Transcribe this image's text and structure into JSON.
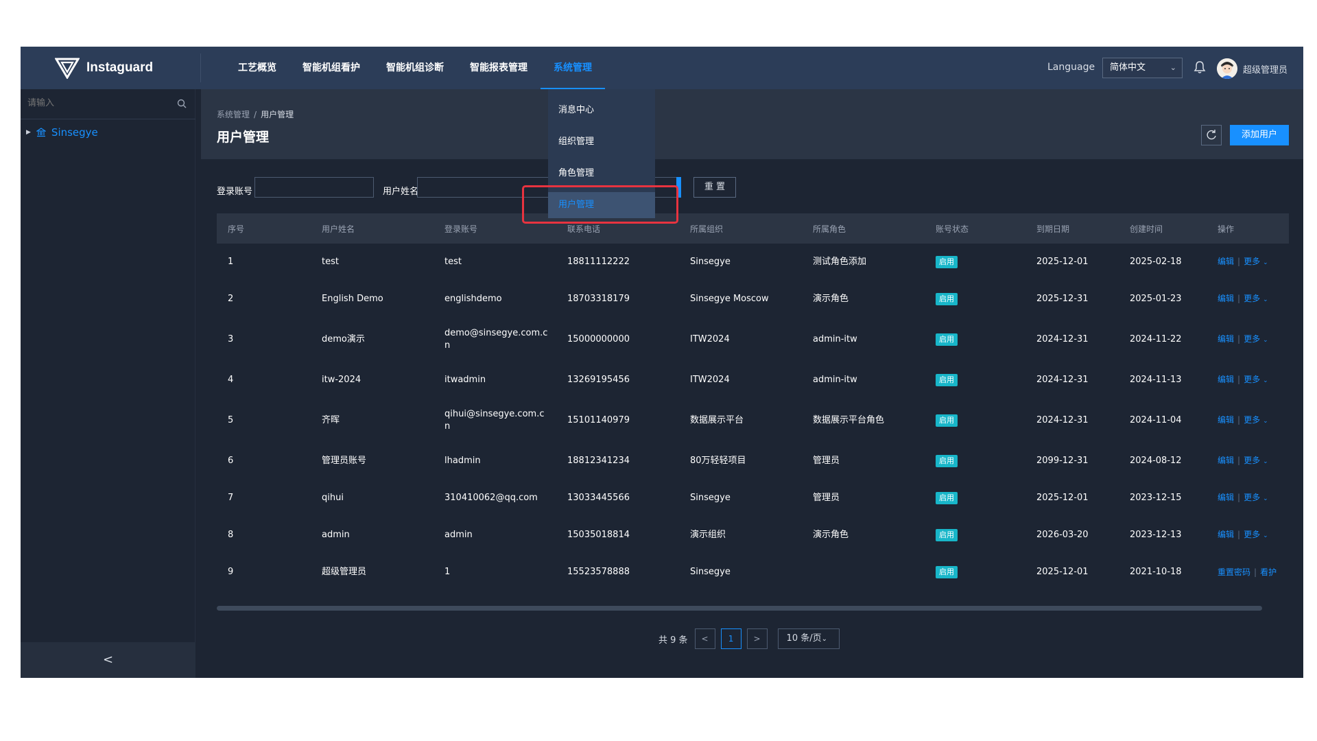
{
  "app": {
    "name": "Instaguard",
    "nav": [
      "工艺概览",
      "智能机组看护",
      "智能机组诊断",
      "智能报表管理",
      "系统管理"
    ],
    "nav_active_index": 4,
    "language_label": "Language",
    "language_value": "简体中文",
    "user_name": "超级管理员",
    "accent_color": "#1890ff"
  },
  "sidebar": {
    "search_placeholder": "请输入",
    "tree_root": "Sinsegye",
    "collapse_glyph": "<"
  },
  "page": {
    "breadcrumb": [
      "系统管理",
      "用户管理"
    ],
    "breadcrumb_sep": "/",
    "title": "用户管理",
    "add_button": "添加用户"
  },
  "filter": {
    "login_label": "登录账号",
    "login_value": "",
    "name_label": "用户姓名",
    "name_value": "",
    "reset_button": "重 置"
  },
  "dropdown": {
    "items": [
      "消息中心",
      "组织管理",
      "角色管理",
      "用户管理"
    ],
    "active_index": 3
  },
  "table": {
    "columns": [
      "序号",
      "用户姓名",
      "登录账号",
      "联系电话",
      "所属组织",
      "所属角色",
      "账号状态",
      "到期日期",
      "创建时间",
      "操作"
    ],
    "rows": [
      {
        "no": "1",
        "name": "test",
        "account": "test",
        "phone": "18811112222",
        "org": "Sinsegye",
        "role": "测试角色添加",
        "status": "启用",
        "expire": "2025-12-01",
        "created": "2025-02-18",
        "op1": "编辑",
        "op2": "更多"
      },
      {
        "no": "2",
        "name": "English Demo",
        "account": "englishdemo",
        "phone": "18703318179",
        "org": "Sinsegye Moscow",
        "role": "演示角色",
        "status": "启用",
        "expire": "2025-12-31",
        "created": "2025-01-23",
        "op1": "编辑",
        "op2": "更多"
      },
      {
        "no": "3",
        "name": "demo演示",
        "account": "demo@sinsegye.com.cn",
        "phone": "15000000000",
        "org": "ITW2024",
        "role": "admin-itw",
        "status": "启用",
        "expire": "2024-12-31",
        "created": "2024-11-22",
        "op1": "编辑",
        "op2": "更多"
      },
      {
        "no": "4",
        "name": "itw-2024",
        "account": "itwadmin",
        "phone": "13269195456",
        "org": "ITW2024",
        "role": "admin-itw",
        "status": "启用",
        "expire": "2024-12-31",
        "created": "2024-11-13",
        "op1": "编辑",
        "op2": "更多"
      },
      {
        "no": "5",
        "name": "齐晖",
        "account": "qihui@sinsegye.com.cn",
        "phone": "15101140979",
        "org": "数据展示平台",
        "role": "数据展示平台角色",
        "status": "启用",
        "expire": "2024-12-31",
        "created": "2024-11-04",
        "op1": "编辑",
        "op2": "更多"
      },
      {
        "no": "6",
        "name": "管理员账号",
        "account": "lhadmin",
        "phone": "18812341234",
        "org": "80万轻轻项目",
        "role": "管理员",
        "status": "启用",
        "expire": "2099-12-31",
        "created": "2024-08-12",
        "op1": "编辑",
        "op2": "更多"
      },
      {
        "no": "7",
        "name": "qihui",
        "account": "310410062@qq.com",
        "phone": "13033445566",
        "org": "Sinsegye",
        "role": "管理员",
        "status": "启用",
        "expire": "2025-12-01",
        "created": "2023-12-15",
        "op1": "编辑",
        "op2": "更多"
      },
      {
        "no": "8",
        "name": "admin",
        "account": "admin",
        "phone": "15035018814",
        "org": "演示组织",
        "role": "演示角色",
        "status": "启用",
        "expire": "2026-03-20",
        "created": "2023-12-13",
        "op1": "编辑",
        "op2": "更多"
      },
      {
        "no": "9",
        "name": "超级管理员",
        "account": "1",
        "phone": "15523578888",
        "org": "Sinsegye",
        "role": "",
        "status": "启用",
        "expire": "2025-12-01",
        "created": "2021-10-18",
        "op1": "重置密码",
        "op2": "看护"
      }
    ]
  },
  "pagination": {
    "total_text": "共 9 条",
    "prev": "<",
    "current_page": "1",
    "next": ">",
    "page_size": "10 条/页"
  }
}
